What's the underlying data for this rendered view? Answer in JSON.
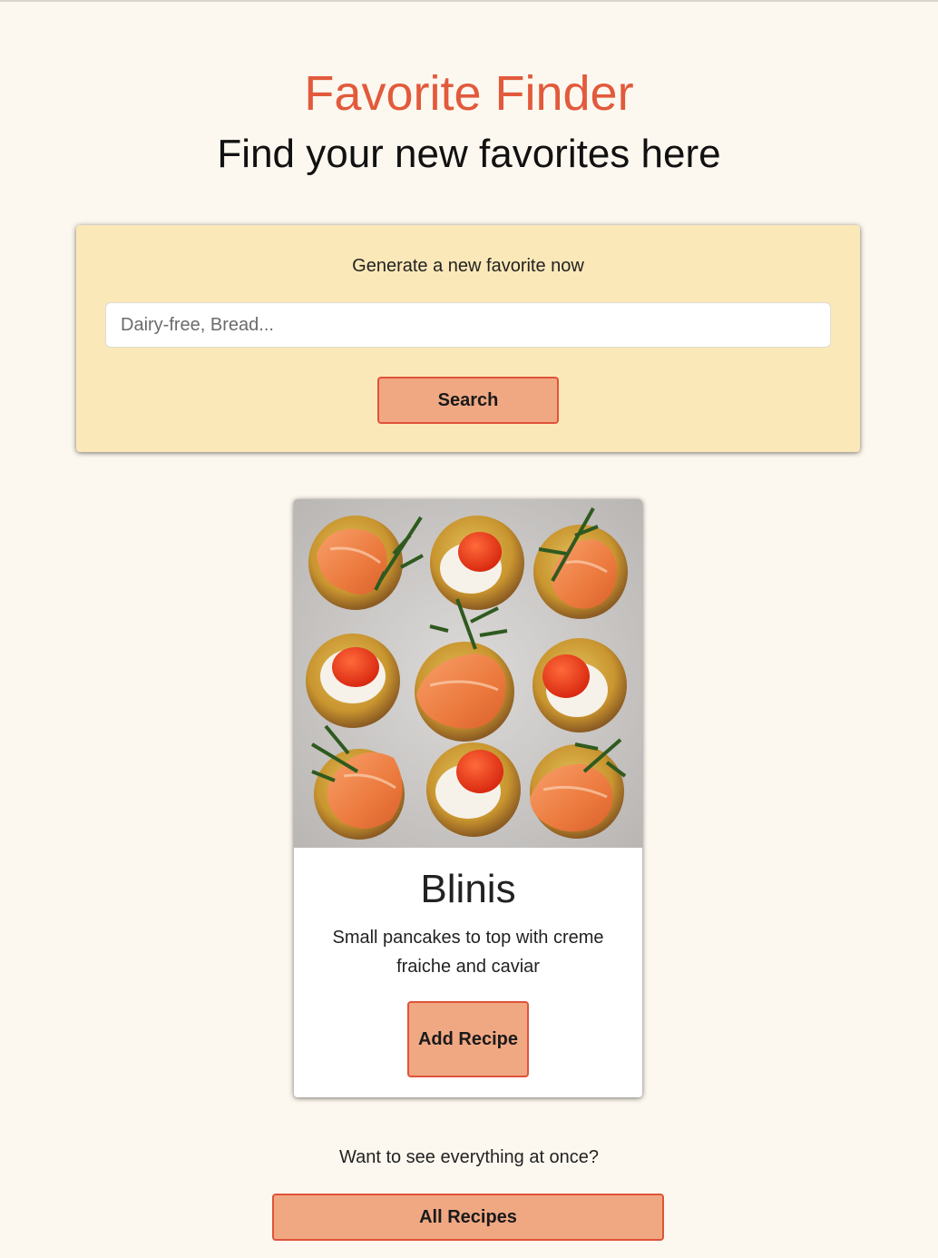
{
  "header": {
    "title": "Favorite Finder",
    "subtitle": "Find your new favorites here"
  },
  "search": {
    "heading": "Generate a new favorite now",
    "placeholder": "Dairy-free, Bread...",
    "value": "",
    "button_label": "Search"
  },
  "recipe_card": {
    "image_alt": "Blinis topped with smoked salmon, creme fraiche, red caviar and dill",
    "title": "Blinis",
    "description": "Small pancakes to top with creme fraiche and caviar",
    "button_label": "Add Recipe"
  },
  "footer": {
    "prompt": "Want to see everything at once?",
    "button_label": "All Recipes"
  },
  "colors": {
    "page_background": "#fdf8ef",
    "title": "#e25a3c",
    "panel_background": "#fbe8b8",
    "button_fill": "#f0a883",
    "button_border": "#e0533a"
  }
}
